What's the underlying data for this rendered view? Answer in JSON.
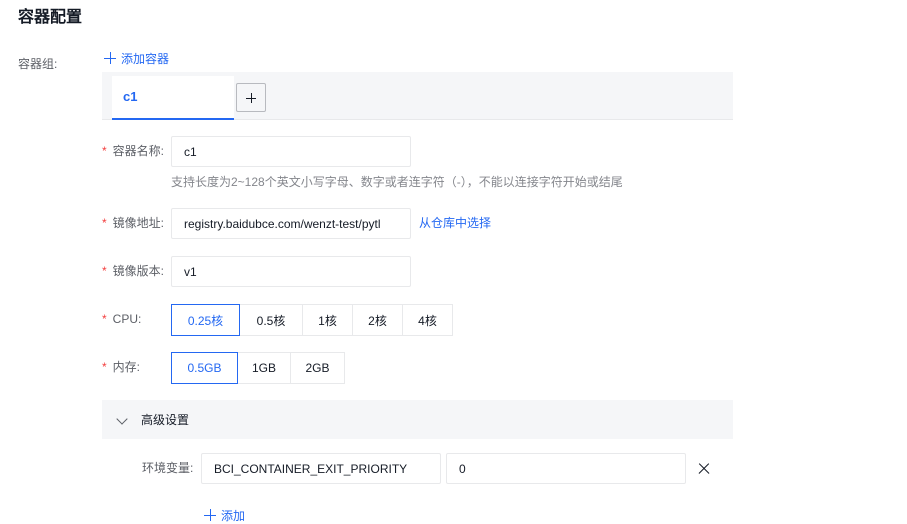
{
  "page": {
    "title": "容器配置"
  },
  "container_group": {
    "label": "容器组:",
    "add_label": "添加容器",
    "tabs": [
      {
        "label": "c1",
        "active": true
      }
    ]
  },
  "form": {
    "name": {
      "label": "容器名称:",
      "value": "c1",
      "hint": "支持长度为2~128个英文小写字母、数字或者连字符（-），不能以连接字符开始或结尾"
    },
    "image": {
      "label": "镜像地址:",
      "value": "registry.baidubce.com/wenzt-test/pytl",
      "select_link": "从仓库中选择"
    },
    "version": {
      "label": "镜像版本:",
      "value": "v1"
    },
    "cpu": {
      "label": "CPU:",
      "options": [
        "0.25核",
        "0.5核",
        "1核",
        "2核",
        "4核"
      ],
      "selected": "0.25核"
    },
    "memory": {
      "label": "内存:",
      "options": [
        "0.5GB",
        "1GB",
        "2GB"
      ],
      "selected": "0.5GB"
    }
  },
  "advanced": {
    "title": "高级设置",
    "env": {
      "label": "环境变量:",
      "key": "BCI_CONTAINER_EXIT_PRIORITY",
      "value": "0",
      "add_label": "添加"
    }
  },
  "colors": {
    "accent": "#2468f2",
    "required": "#f33e3e",
    "panel": "#f5f6f8"
  },
  "icons": [
    "plus-icon",
    "close-icon",
    "chevron-down-icon"
  ]
}
